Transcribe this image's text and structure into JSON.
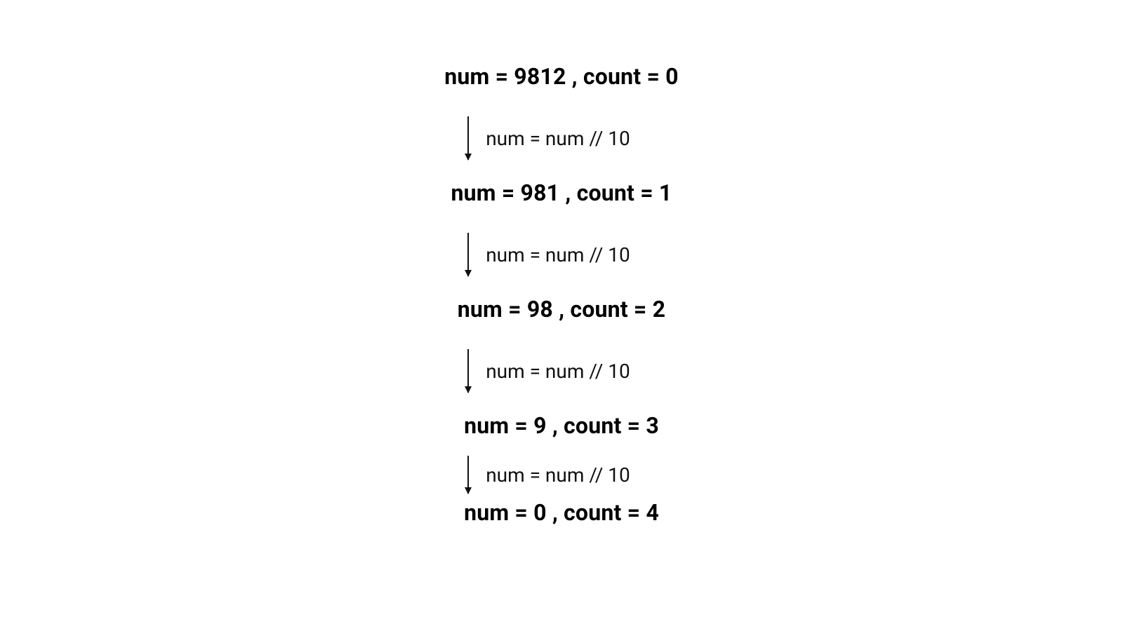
{
  "chart_data": {
    "type": "flow",
    "title": "",
    "nodes": [
      {
        "num": 9812,
        "count": 0
      },
      {
        "num": 981,
        "count": 1
      },
      {
        "num": 98,
        "count": 2
      },
      {
        "num": 9,
        "count": 3
      },
      {
        "num": 0,
        "count": 4
      }
    ],
    "edges": [
      {
        "op": "num = num // 10"
      },
      {
        "op": "num = num // 10"
      },
      {
        "op": "num = num // 10"
      },
      {
        "op": "num = num // 10"
      }
    ]
  },
  "labels": {
    "state0": "num = 9812 , count = 0",
    "state1": "num = 981 , count = 1",
    "state2": "num = 98 , count = 2",
    "state3": "num = 9 , count = 3",
    "state4": "num = 0 , count = 4",
    "op0": "num = num // 10",
    "op1": "num = num // 10",
    "op2": "num = num // 10",
    "op3": "num = num // 10"
  }
}
